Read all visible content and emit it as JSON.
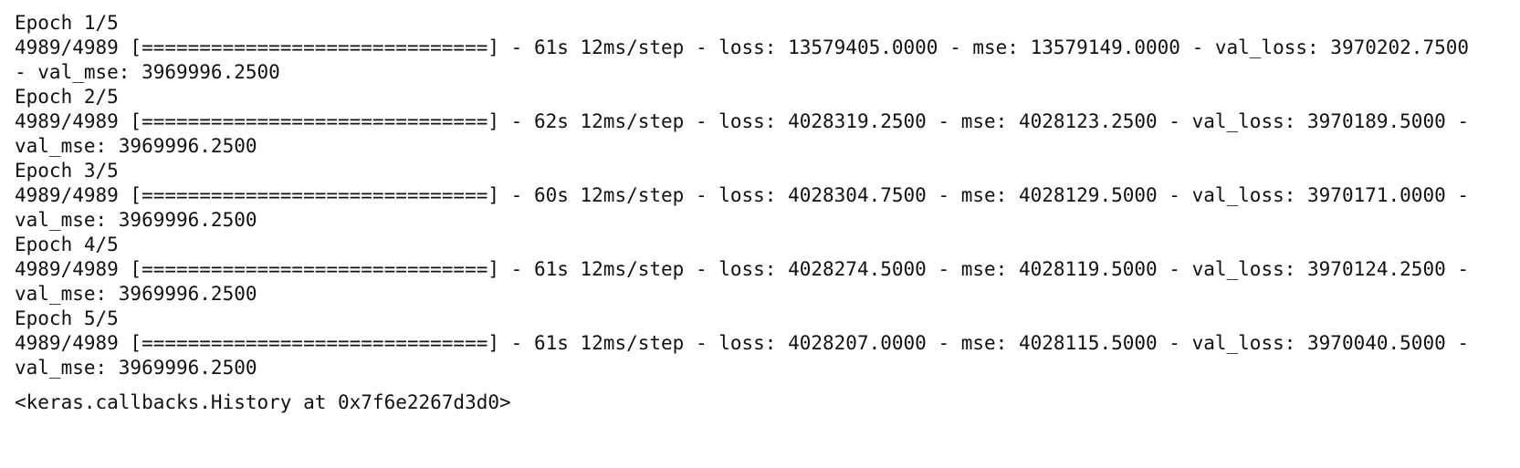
{
  "output": {
    "lines": [
      "Epoch 1/5",
      "4989/4989 [==============================] - 61s 12ms/step - loss: 13579405.0000 - mse: 13579149.0000 - val_loss: 3970202.7500",
      "- val_mse: 3969996.2500",
      "Epoch 2/5",
      "4989/4989 [==============================] - 62s 12ms/step - loss: 4028319.2500 - mse: 4028123.2500 - val_loss: 3970189.5000 -",
      "val_mse: 3969996.2500",
      "Epoch 3/5",
      "4989/4989 [==============================] - 60s 12ms/step - loss: 4028304.7500 - mse: 4028129.5000 - val_loss: 3970171.0000 -",
      "val_mse: 3969996.2500",
      "Epoch 4/5",
      "4989/4989 [==============================] - 61s 12ms/step - loss: 4028274.5000 - mse: 4028119.5000 - val_loss: 3970124.2500 -",
      "val_mse: 3969996.2500",
      "Epoch 5/5",
      "4989/4989 [==============================] - 61s 12ms/step - loss: 4028207.0000 - mse: 4028115.5000 - val_loss: 3970040.5000 -",
      "val_mse: 3969996.2500"
    ],
    "result": "<keras.callbacks.History at 0x7f6e2267d3d0>"
  }
}
